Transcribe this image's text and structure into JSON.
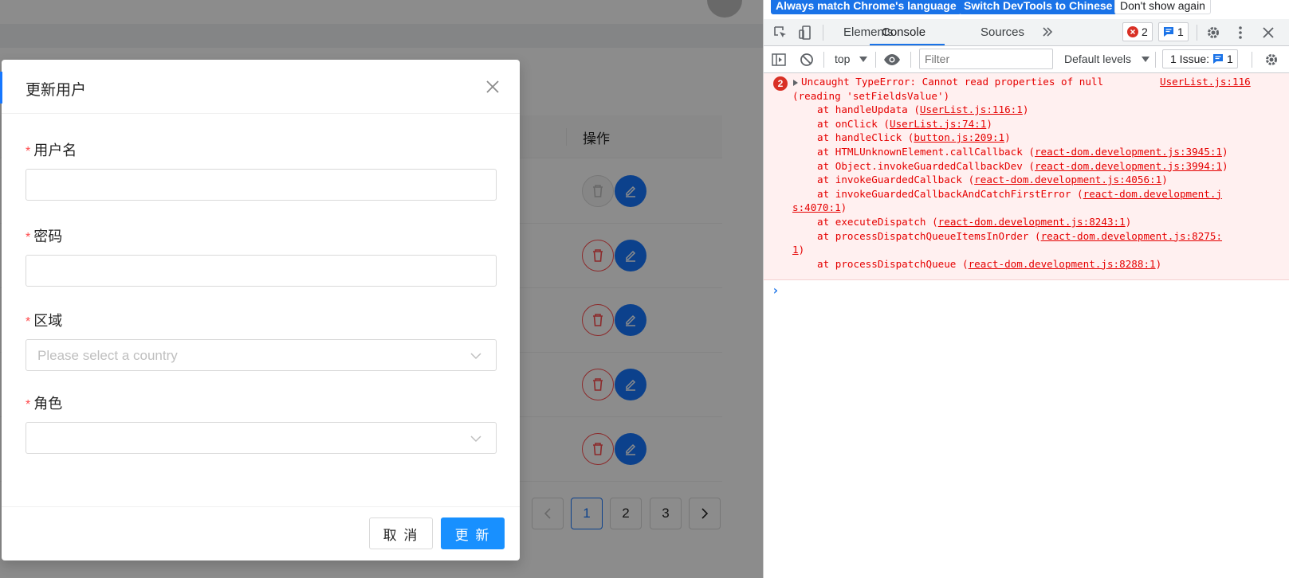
{
  "app": {
    "table_header_action": "操作",
    "rows": [
      {
        "delete_disabled": true
      },
      {
        "delete_disabled": false
      },
      {
        "delete_disabled": false
      },
      {
        "delete_disabled": false
      },
      {
        "delete_disabled": false
      }
    ],
    "pagination": [
      "1",
      "2",
      "3"
    ],
    "current_page": "1"
  },
  "modal": {
    "title": "更新用户",
    "fields": {
      "username": {
        "label": "用户名",
        "value": ""
      },
      "password": {
        "label": "密码",
        "value": ""
      },
      "region": {
        "label": "区域",
        "placeholder": "Please select a country"
      },
      "role": {
        "label": "角色",
        "placeholder": ""
      }
    },
    "required_mark": "*",
    "cancel_label": "取 消",
    "ok_label": "更 新"
  },
  "devtools": {
    "infobar": {
      "match_language": "Always match Chrome's language",
      "switch_chinese": "Switch DevTools to Chinese",
      "dont_show": "Don't show again"
    },
    "tabs": [
      "Elements",
      "Console",
      "Sources"
    ],
    "active_tab": "Console",
    "error_count": "2",
    "message_count": "1",
    "context": "top",
    "filter_placeholder": "Filter",
    "levels": "Default levels",
    "issues_label": "1 Issue:",
    "issues_count": "1",
    "error": {
      "count": "2",
      "message": "Uncaught TypeError: Cannot read properties of null",
      "message2": "(reading 'setFieldsValue')",
      "source": "UserList.js:116",
      "stack": [
        {
          "fn": "handleUpdata",
          "loc": "UserList.js:116:1"
        },
        {
          "fn": "onClick",
          "loc": "UserList.js:74:1"
        },
        {
          "fn": "handleClick",
          "loc": "button.js:209:1"
        },
        {
          "fn": "HTMLUnknownElement.callCallback",
          "loc": "react-dom.development.js:3945:1"
        },
        {
          "fn": "Object.invokeGuardedCallbackDev",
          "loc": "react-dom.development.js:3994:1"
        },
        {
          "fn": "invokeGuardedCallback",
          "loc": "react-dom.development.js:4056:1"
        },
        {
          "fn": "invokeGuardedCallbackAndCatchFirstError",
          "loc_a": "react-dom.development.j",
          "loc_b": "s:4070:1"
        },
        {
          "fn": "executeDispatch",
          "loc": "react-dom.development.js:8243:1"
        },
        {
          "fn": "processDispatchQueueItemsInOrder",
          "loc_a": "react-dom.development.js:8275:",
          "loc_b": "1"
        },
        {
          "fn": "processDispatchQueue",
          "loc": "react-dom.development.js:8288:1"
        }
      ]
    },
    "prompt_symbol": "›"
  },
  "colors": {
    "primary": "#1677ff",
    "danger": "#ff4d4f",
    "console_error": "#e50000",
    "devtools_blue": "#1a73e8"
  }
}
